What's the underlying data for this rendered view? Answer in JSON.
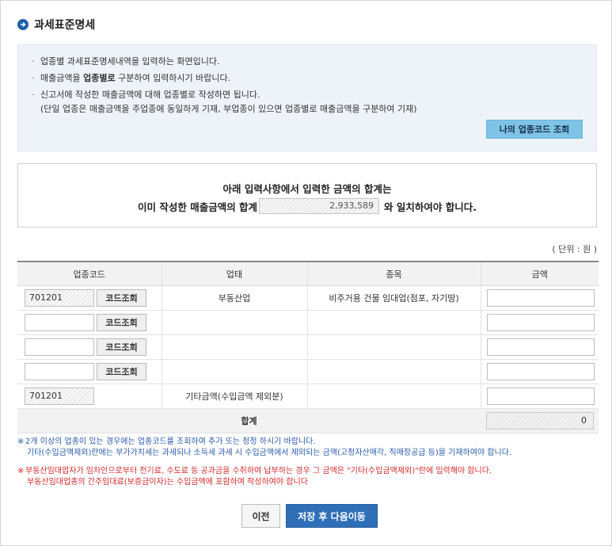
{
  "page": {
    "title": "과세표준명세"
  },
  "info": {
    "items": [
      "업종별 과세표준명세내역을 입력하는 화면입니다.",
      "매출금액을 업종별로 구분하여 입력하시기 바랍니다.",
      "신고서에 작성한 매출금액에 대해 업종별로 작성하면 됩니다."
    ],
    "item2_prefix": "매출금액을 ",
    "item2_bold": "업종별로",
    "item2_suffix": " 구분하여 입력하시기 바랍니다.",
    "item3_sub": "(단일 업종은 매출금액을 주업종에 동일하게 기재, 부업종이 있으면 업종별로 매출금액을 구분하여 기재)",
    "my_code_button": "나의 업종코드 조회"
  },
  "summary": {
    "line1": "아래 입력사항에서  입력한 금액의 합계는",
    "line2_prefix": "이미 작성한 매출금액의 합계",
    "amount": "2,933,589",
    "line2_suffix": "와 일치하여야 합니다."
  },
  "unit": "( 단위 : 원 )",
  "table": {
    "headers": {
      "code": "업종코드",
      "business": "업태",
      "item": "종목",
      "amount": "금액"
    },
    "lookup_label": "코드조회",
    "rows": [
      {
        "code": "701201",
        "business": "부동산업",
        "item": "비주거용 건물 임대업(점포, 자기땅)",
        "amount": ""
      },
      {
        "code": "",
        "business": "",
        "item": "",
        "amount": ""
      },
      {
        "code": "",
        "business": "",
        "item": "",
        "amount": ""
      },
      {
        "code": "",
        "business": "",
        "item": "",
        "amount": ""
      }
    ],
    "other_row": {
      "code": "701201",
      "label": "기타금액(수입금액 제외분)",
      "amount": ""
    },
    "total_label": "합계",
    "total_value": "0"
  },
  "notes": {
    "mark": "※",
    "note1_line1": "2개 이상의 업종이 있는 경우에는 업종코드를 조회하여 추가 또는 정정 하시기 바랍니다.",
    "note1_line2": "기타(수입금액제외)란에는 부가가치세는 과세되나 소득세 과세 시 수입금액에서 제외되는 금액(고정자산매각, 직매장공급 등)을 기재하여야 합니다.",
    "note2_line1": "부동산임대업자가 임차인으로부터 전기료, 수도료 등 공과금을 수취하여 납부하는 경우 그 금액은 \"기타(수입금액제외)\"란에 입력해야 합니다.",
    "note2_line2": "부동산임대업종의 간주임대료(보증금이자)는 수입금액에 포함하여 작성하여야 합니다",
    "note1_color": "#2a5ba8",
    "note2_color": "#d22b2b"
  },
  "buttons": {
    "prev": "이전",
    "save_next": "저장 후 다음이동"
  },
  "colors": {
    "primary": "#2f6fb8",
    "accent_button": "#7fc3e6",
    "info_bg": "#eef3fa"
  }
}
